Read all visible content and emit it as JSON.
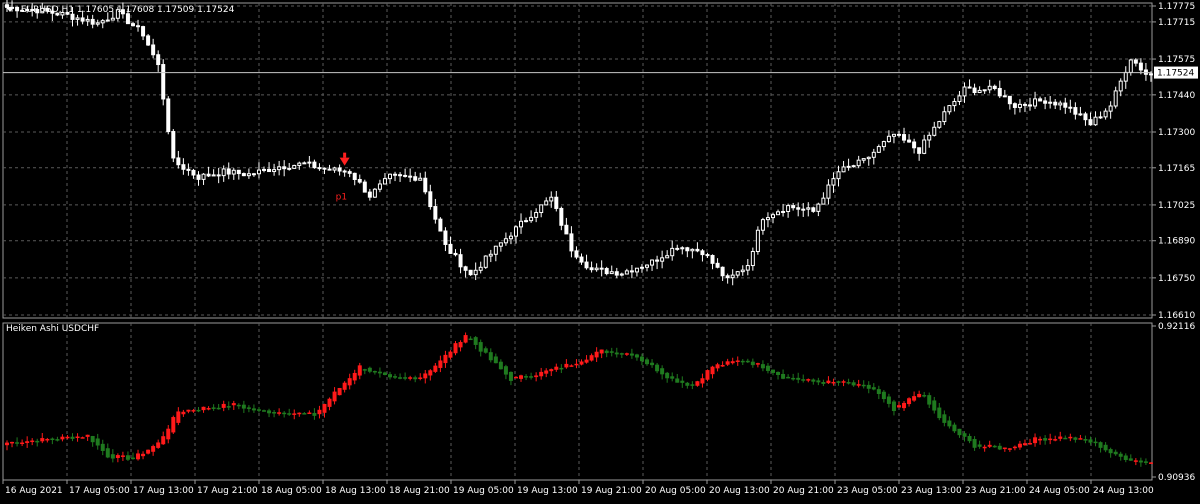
{
  "header": {
    "symbol": "EURUSD,H1",
    "ohlc": "1.17605 1.17608 1.17509 1.17524"
  },
  "indicator": {
    "title": "Heiken Ashi USDCHF"
  },
  "colors": {
    "bull": "#ffffff",
    "bear": "#ffffff",
    "ha_up": "#1f7a1f",
    "ha_down": "#ff1a1a",
    "grid": "#5a5a5a",
    "price_tag_bg": "#ffffff",
    "price_tag_fg": "#000000",
    "marker": "#ff2020"
  },
  "chart_data": [
    {
      "type": "candlestick",
      "series": [
        {
          "name": "EURUSD,H1"
        }
      ],
      "ylim": [
        1.1661,
        1.17775
      ],
      "y_ticks": [
        "1.17775",
        "1.17715",
        "1.17575",
        "1.17440",
        "1.17300",
        "1.17165",
        "1.17025",
        "1.16890",
        "1.16750",
        "1.16610"
      ],
      "y_tick_values": [
        1.17775,
        1.17715,
        1.17575,
        1.1744,
        1.173,
        1.17165,
        1.17025,
        1.1689,
        1.1675,
        1.1661
      ],
      "current_price": "1.17524",
      "current_price_value": 1.17524,
      "marker_label": "p1",
      "close_anchors": [
        [
          0,
          1.1777
        ],
        [
          6,
          1.1776
        ],
        [
          12,
          1.1774
        ],
        [
          18,
          1.1771
        ],
        [
          22,
          1.1775
        ],
        [
          27,
          1.1767
        ],
        [
          30,
          1.1755
        ],
        [
          33,
          1.1719
        ],
        [
          38,
          1.1713
        ],
        [
          43,
          1.1715
        ],
        [
          48,
          1.1714
        ],
        [
          54,
          1.1717
        ],
        [
          59,
          1.1718
        ],
        [
          63,
          1.1716
        ],
        [
          68,
          1.1715
        ],
        [
          72,
          1.1706
        ],
        [
          76,
          1.1713
        ],
        [
          82,
          1.1713
        ],
        [
          87,
          1.1687
        ],
        [
          92,
          1.1676
        ],
        [
          98,
          1.1688
        ],
        [
          104,
          1.1699
        ],
        [
          108,
          1.1705
        ],
        [
          112,
          1.1686
        ],
        [
          116,
          1.1678
        ],
        [
          122,
          1.1677
        ],
        [
          128,
          1.1681
        ],
        [
          133,
          1.1687
        ],
        [
          138,
          1.1685
        ],
        [
          143,
          1.1674
        ],
        [
          147,
          1.168
        ],
        [
          150,
          1.1698
        ],
        [
          155,
          1.1702
        ],
        [
          160,
          1.17
        ],
        [
          165,
          1.1715
        ],
        [
          170,
          1.1719
        ],
        [
          176,
          1.1729
        ],
        [
          181,
          1.1723
        ],
        [
          186,
          1.1737
        ],
        [
          190,
          1.1746
        ],
        [
          196,
          1.1746
        ],
        [
          200,
          1.174
        ],
        [
          206,
          1.1742
        ],
        [
          210,
          1.174
        ],
        [
          215,
          1.1733
        ],
        [
          219,
          1.174
        ],
        [
          223,
          1.1758
        ],
        [
          226,
          1.1752
        ]
      ]
    },
    {
      "type": "candlestick",
      "series": [
        {
          "name": "Heiken Ashi USDCHF"
        }
      ],
      "ylim": [
        0.90936,
        0.92116
      ],
      "y_ticks": [
        "0.92116",
        "0.90936"
      ],
      "y_tick_values": [
        0.92116,
        0.90936
      ],
      "close_anchors": [
        [
          0,
          0.91205
        ],
        [
          8,
          0.9123
        ],
        [
          16,
          0.9126
        ],
        [
          20,
          0.911
        ],
        [
          25,
          0.9108
        ],
        [
          30,
          0.912
        ],
        [
          34,
          0.9145
        ],
        [
          40,
          0.9148
        ],
        [
          45,
          0.915
        ],
        [
          50,
          0.9145
        ],
        [
          56,
          0.9144
        ],
        [
          61,
          0.9142
        ],
        [
          64,
          0.9155
        ],
        [
          70,
          0.918
        ],
        [
          76,
          0.917
        ],
        [
          82,
          0.9172
        ],
        [
          86,
          0.9184
        ],
        [
          91,
          0.9205
        ],
        [
          96,
          0.9185
        ],
        [
          100,
          0.917
        ],
        [
          106,
          0.9175
        ],
        [
          112,
          0.9182
        ],
        [
          118,
          0.9192
        ],
        [
          124,
          0.919
        ],
        [
          128,
          0.918
        ],
        [
          132,
          0.917
        ],
        [
          136,
          0.9165
        ],
        [
          140,
          0.918
        ],
        [
          146,
          0.9185
        ],
        [
          150,
          0.918
        ],
        [
          154,
          0.9172
        ],
        [
          160,
          0.9168
        ],
        [
          166,
          0.9167
        ],
        [
          172,
          0.9162
        ],
        [
          176,
          0.9145
        ],
        [
          181,
          0.916
        ],
        [
          186,
          0.9135
        ],
        [
          192,
          0.9118
        ],
        [
          198,
          0.9116
        ],
        [
          204,
          0.9123
        ],
        [
          210,
          0.9125
        ],
        [
          216,
          0.912
        ],
        [
          220,
          0.911
        ],
        [
          226,
          0.9105
        ]
      ]
    }
  ],
  "x_labels": [
    "16 Aug 2021",
    "17 Aug 05:00",
    "17 Aug 13:00",
    "17 Aug 21:00",
    "18 Aug 05:00",
    "18 Aug 13:00",
    "18 Aug 21:00",
    "19 Aug 05:00",
    "19 Aug 13:00",
    "19 Aug 21:00",
    "20 Aug 05:00",
    "20 Aug 13:00",
    "20 Aug 21:00",
    "23 Aug 05:00",
    "23 Aug 13:00",
    "23 Aug 21:00",
    "24 Aug 05:00",
    "24 Aug 13:00"
  ]
}
